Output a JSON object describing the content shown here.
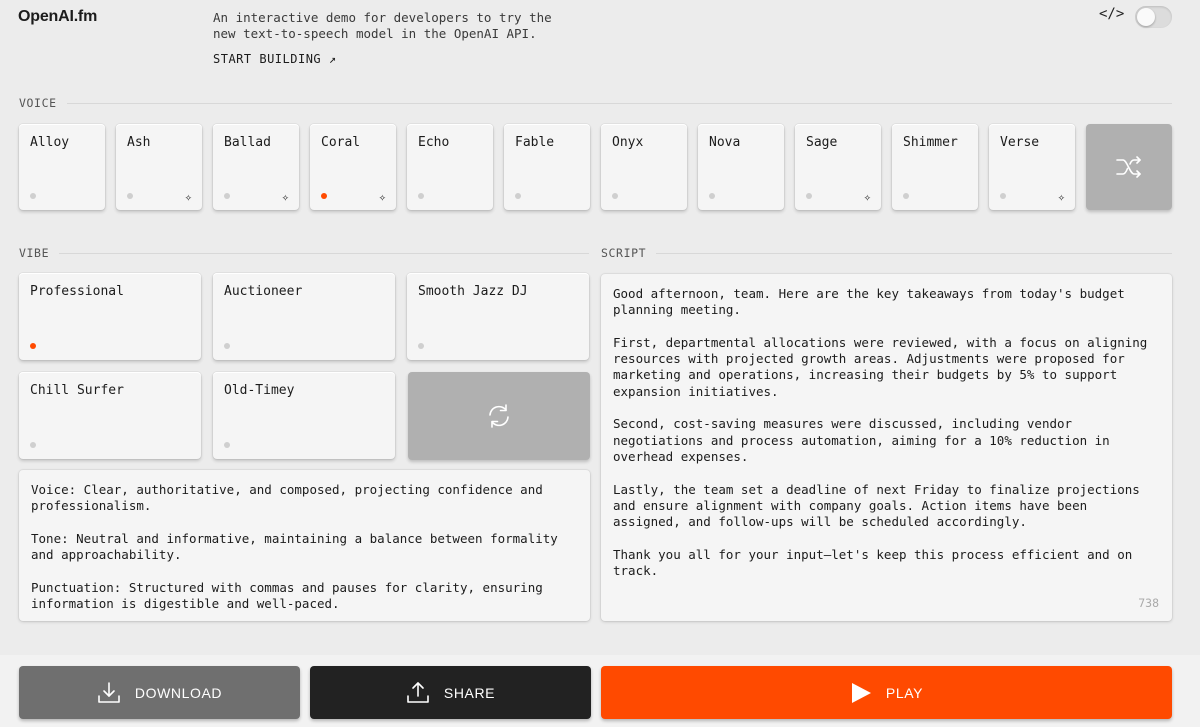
{
  "header": {
    "logo": "OpenAI.fm",
    "intro": "An interactive demo for developers to try the new text-to-speech model in the OpenAI API.",
    "start_label": "START BUILDING ↗",
    "code_icon": "</>",
    "dark_mode_on": false
  },
  "voice": {
    "label": "VOICE",
    "items": [
      {
        "name": "Alloy",
        "selected": false,
        "spark": false
      },
      {
        "name": "Ash",
        "selected": false,
        "spark": true
      },
      {
        "name": "Ballad",
        "selected": false,
        "spark": true
      },
      {
        "name": "Coral",
        "selected": true,
        "spark": true
      },
      {
        "name": "Echo",
        "selected": false,
        "spark": false
      },
      {
        "name": "Fable",
        "selected": false,
        "spark": false
      },
      {
        "name": "Onyx",
        "selected": false,
        "spark": false
      },
      {
        "name": "Nova",
        "selected": false,
        "spark": false
      },
      {
        "name": "Sage",
        "selected": false,
        "spark": true
      },
      {
        "name": "Shimmer",
        "selected": false,
        "spark": false
      },
      {
        "name": "Verse",
        "selected": false,
        "spark": true
      }
    ],
    "shuffle_icon": "shuffle-icon"
  },
  "vibe": {
    "label": "VIBE",
    "items": [
      {
        "name": "Professional",
        "selected": true
      },
      {
        "name": "Auctioneer",
        "selected": false
      },
      {
        "name": "Smooth Jazz DJ",
        "selected": false
      },
      {
        "name": "Chill Surfer",
        "selected": false
      },
      {
        "name": "Old-Timey",
        "selected": false
      }
    ],
    "refresh_icon": "refresh-icon",
    "description": [
      "Voice: Clear, authoritative, and composed, projecting confidence and professionalism.",
      "Tone: Neutral and informative, maintaining a balance between formality and approachability.",
      "Punctuation: Structured with commas and pauses for clarity, ensuring information is digestible and well-paced."
    ]
  },
  "script": {
    "label": "SCRIPT",
    "paragraphs": [
      "Good afternoon, team. Here are the key takeaways from today's budget planning meeting.",
      "First, departmental allocations were reviewed, with a focus on aligning resources with projected growth areas. Adjustments were proposed for marketing and operations, increasing their budgets by 5% to support expansion initiatives.",
      "Second, cost-saving measures were discussed, including vendor negotiations and process automation, aiming for a 10% reduction in overhead expenses.",
      "Lastly, the team set a deadline of next Friday to finalize projections and ensure alignment with company goals. Action items have been assigned, and follow-ups will be scheduled accordingly.",
      "Thank you all for your input—let's keep this process efficient and on track."
    ],
    "char_count": "738"
  },
  "actions": {
    "download": "DOWNLOAD",
    "share": "SHARE",
    "play": "PLAY"
  },
  "colors": {
    "accent": "#ff4a00",
    "download_bg": "#6f6f6f",
    "share_bg": "#222222"
  }
}
